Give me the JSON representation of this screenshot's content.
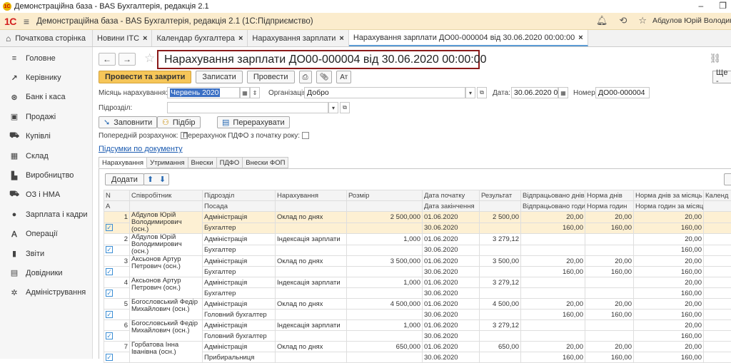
{
  "window": {
    "title": "Демонстраційна база - BAS Бухгалтерія, редакція 2.1",
    "min": "–",
    "restore": "❐"
  },
  "appbar": {
    "brand": "1С",
    "menu": "≡",
    "title": "Демонстраційна база - BAS Бухгалтерія, редакція 2.1  (1С:Підприємство)",
    "user": "Абдулов Юрій Володимирович"
  },
  "tabs": {
    "home": "Початкова сторінка",
    "items": [
      {
        "label": "Новини ІТС",
        "close": "×"
      },
      {
        "label": "Календар бухгалтера",
        "close": "×"
      },
      {
        "label": "Нарахування зарплати",
        "close": "×"
      },
      {
        "label": "Нарахування зарплати ДО00-000004 від 30.06.2020 00:00:00",
        "close": "×"
      }
    ]
  },
  "sidebar": {
    "items": [
      {
        "label": "Головне",
        "icon": "≡"
      },
      {
        "label": "Керівнику",
        "icon": "↗"
      },
      {
        "label": "Банк і каса",
        "icon": "⊛"
      },
      {
        "label": "Продажі",
        "icon": "▣"
      },
      {
        "label": "Купівлі",
        "icon": "⛟"
      },
      {
        "label": "Склад",
        "icon": "▦"
      },
      {
        "label": "Виробництво",
        "icon": "▙"
      },
      {
        "label": "ОЗ і НМА",
        "icon": "⛟"
      },
      {
        "label": "Зарплата і кадри",
        "icon": "●"
      },
      {
        "label": "Операції",
        "icon": "Ａ"
      },
      {
        "label": "Звіти",
        "icon": "▮"
      },
      {
        "label": "Довідники",
        "icon": "▤"
      },
      {
        "label": "Адміністрування",
        "icon": "✲"
      }
    ]
  },
  "doc": {
    "back": "←",
    "forward": "→",
    "star": "☆",
    "title": "Нарахування зарплати ДО00-000004 від 30.06.2020 00:00:00",
    "link_icon": "🔗"
  },
  "toolbar": {
    "post_close": "Провести та закрити",
    "save": "Записати",
    "post": "Провести",
    "more": "Ще -"
  },
  "form": {
    "month_label": "Місяць нарахування:",
    "month_value": "Червень 2020",
    "org_label": "Організація:",
    "org_value": "Добро",
    "date_label": "Дата:",
    "date_value": "30.06.2020 0",
    "number_label": "Номер:",
    "number_value": "ДО00-000004",
    "dept_label": "Підрозділ:",
    "dept_value": "",
    "fill_btn": "Заповнити",
    "pick_btn": "Підбір",
    "recalc_btn": "Перерахувати",
    "prelim_label": "Попередній розрахунок:",
    "pdfo_label": "Перерахунок ПДФО з початку року:",
    "totals_link": "Підсумки по документу"
  },
  "subtabs": [
    "Нарахування",
    "Утримання",
    "Внески",
    "ПДФО",
    "Внески ФОП"
  ],
  "grid": {
    "add": "Додати",
    "headers1": [
      "N",
      "Співробітник",
      "Підрозділ",
      "Нарахування",
      "Розмір",
      "Дата початку",
      "Результат",
      "Відпрацьовано днів",
      "Норма днів",
      "Норма днів за місяць",
      "Календ"
    ],
    "headers2": [
      "А",
      "",
      "Посада",
      "",
      "",
      "Дата закінчення",
      "",
      "Відпрацьовано годин",
      "Норма годин",
      "Норма годин за місяць",
      ""
    ],
    "rows": [
      {
        "n": "1",
        "emp": "Абдулов Юрій Володимирович (осн.)",
        "dept": "Адміністрація",
        "pos": "Бухгалтер",
        "accr": "Оклад по днях",
        "size": "2 500,000",
        "start": "01.06.2020",
        "end": "30.06.2020",
        "result": "2 500,00",
        "wd": "20,00",
        "wh": "160,00",
        "nd": "20,00",
        "nh": "160,00",
        "ndm": "20,00",
        "nhm": "160,00"
      },
      {
        "n": "2",
        "emp": "Абдулов Юрій Володимирович (осн.)",
        "dept": "Адміністрація",
        "pos": "Бухгалтер",
        "accr": "Індексація зарплати",
        "size": "1,000",
        "start": "01.06.2020",
        "end": "30.06.2020",
        "result": "3 279,12",
        "wd": "",
        "wh": "",
        "nd": "",
        "nh": "",
        "ndm": "20,00",
        "nhm": "160,00"
      },
      {
        "n": "3",
        "emp": "Аксьонов Артур Петрович (осн.)",
        "dept": "Адміністрація",
        "pos": "Бухгалтер",
        "accr": "Оклад по днях",
        "size": "3 500,000",
        "start": "01.06.2020",
        "end": "30.06.2020",
        "result": "3 500,00",
        "wd": "20,00",
        "wh": "160,00",
        "nd": "20,00",
        "nh": "160,00",
        "ndm": "20,00",
        "nhm": "160,00"
      },
      {
        "n": "4",
        "emp": "Аксьонов Артур Петрович (осн.)",
        "dept": "Адміністрація",
        "pos": "Бухгалтер",
        "accr": "Індексація зарплати",
        "size": "1,000",
        "start": "01.06.2020",
        "end": "30.06.2020",
        "result": "3 279,12",
        "wd": "",
        "wh": "",
        "nd": "",
        "nh": "",
        "ndm": "20,00",
        "nhm": "160,00"
      },
      {
        "n": "5",
        "emp": "Богословський Федір Михайлович (осн.)",
        "dept": "Адміністрація",
        "pos": "Головний бухгалтер",
        "accr": "Оклад по днях",
        "size": "4 500,000",
        "start": "01.06.2020",
        "end": "30.06.2020",
        "result": "4 500,00",
        "wd": "20,00",
        "wh": "160,00",
        "nd": "20,00",
        "nh": "160,00",
        "ndm": "20,00",
        "nhm": "160,00"
      },
      {
        "n": "6",
        "emp": "Богословський Федір Михайлович (осн.)",
        "dept": "Адміністрація",
        "pos": "Головний бухгалтер",
        "accr": "Індексація зарплати",
        "size": "1,000",
        "start": "01.06.2020",
        "end": "30.06.2020",
        "result": "3 279,12",
        "wd": "",
        "wh": "",
        "nd": "",
        "nh": "",
        "ndm": "20,00",
        "nhm": "160,00"
      },
      {
        "n": "7",
        "emp": "Горбатова Інна Іванівна (осн.)",
        "dept": "Адміністрація",
        "pos": "Прибиральниця",
        "accr": "Оклад по днях",
        "size": "650,000",
        "start": "01.06.2020",
        "end": "30.06.2020",
        "result": "650,00",
        "wd": "20,00",
        "wh": "160,00",
        "nd": "20,00",
        "nh": "160,00",
        "ndm": "20,00",
        "nhm": "160,00"
      }
    ]
  }
}
